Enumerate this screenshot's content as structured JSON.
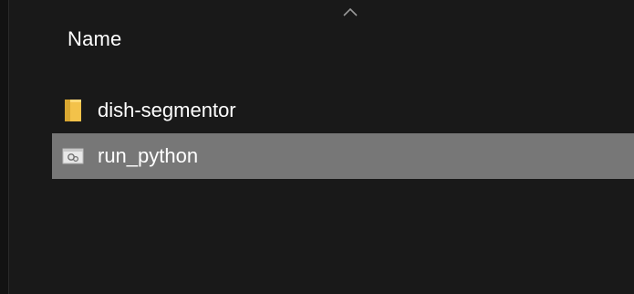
{
  "file_list": {
    "column_header": "Name",
    "sort_direction": "ascending",
    "items": [
      {
        "label": "dish-segmentor",
        "icon": "folder-icon",
        "selected": false
      },
      {
        "label": "run_python",
        "icon": "batch-file-icon",
        "selected": true
      }
    ]
  },
  "colors": {
    "background": "#191919",
    "selection": "#777777",
    "folder": "#f3c24a",
    "text": "#ffffff"
  }
}
